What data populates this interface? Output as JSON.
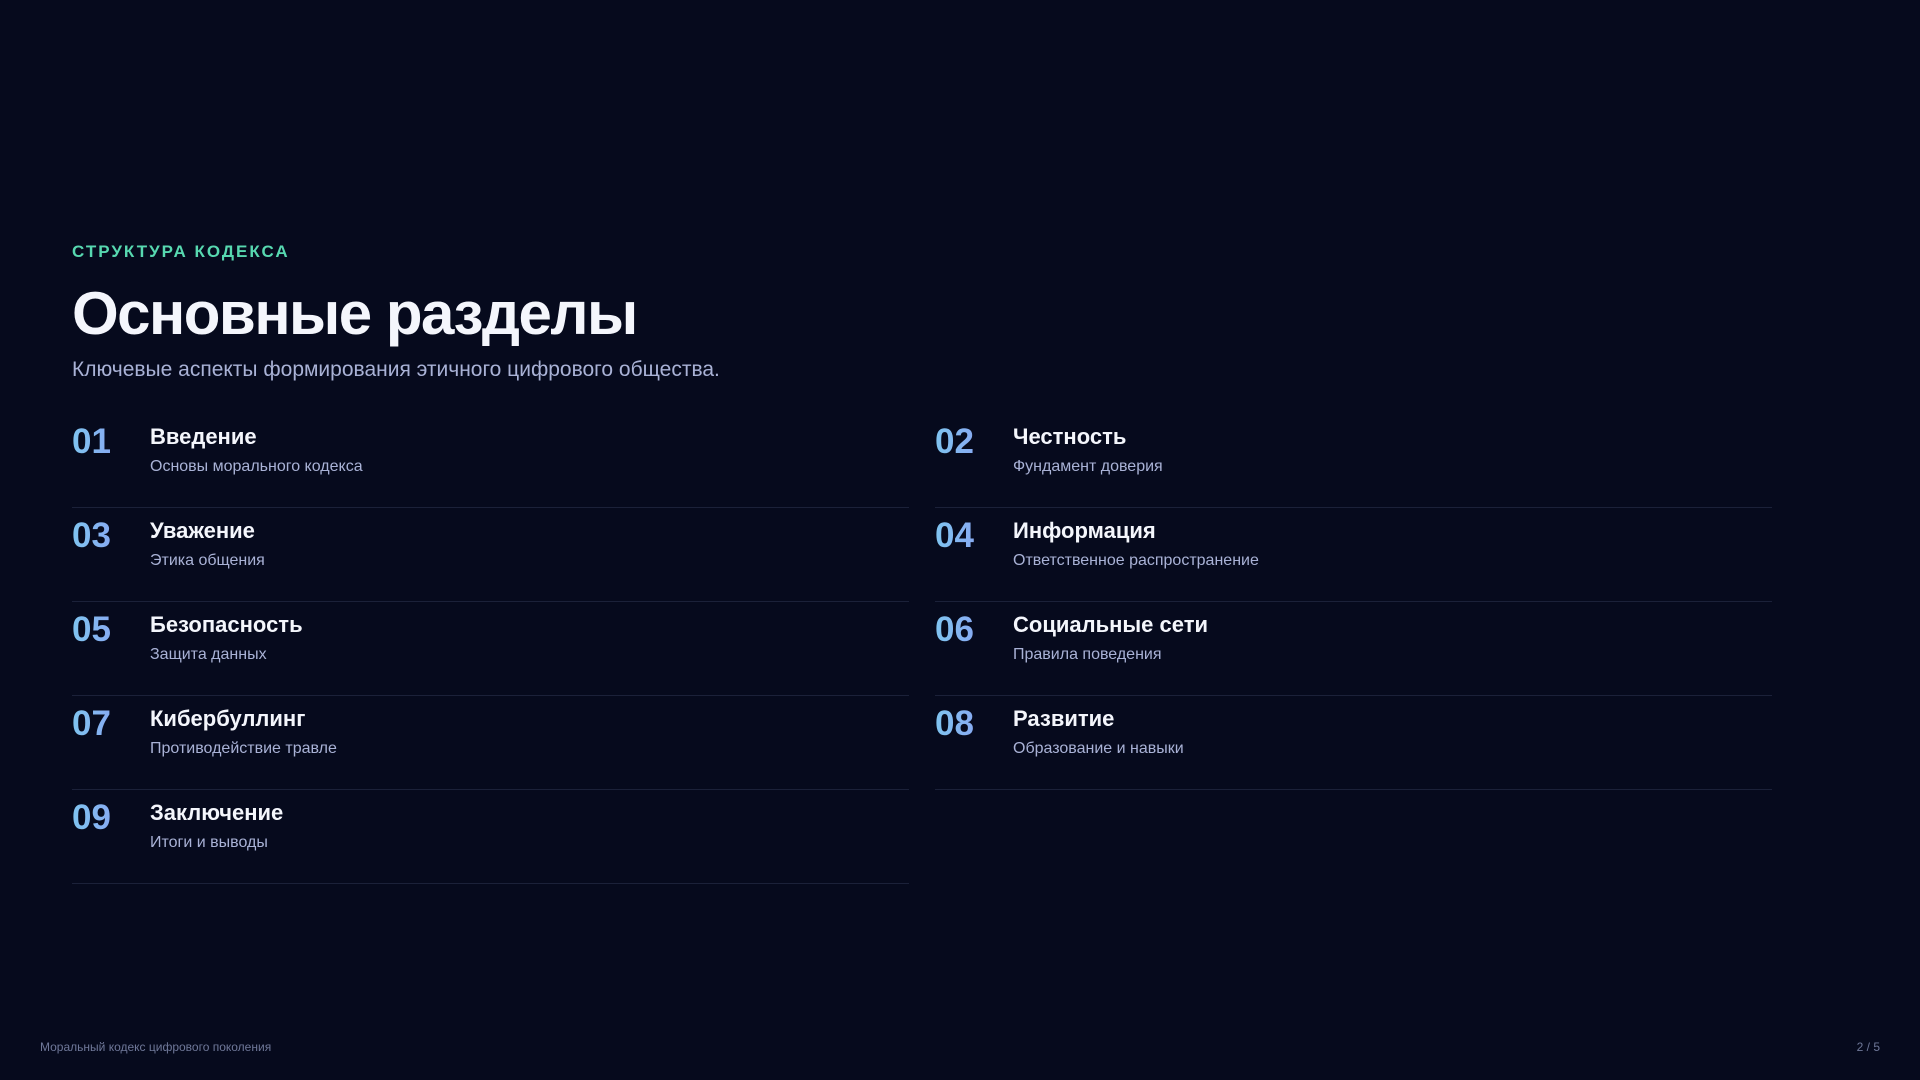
{
  "header": {
    "eyebrow": "СТРУКТУРА КОДЕКСА",
    "title": "Основные разделы",
    "subtitle": "Ключевые аспекты формирования этичного цифрового общества."
  },
  "sections": [
    {
      "num": "01",
      "title": "Введение",
      "desc": "Основы морального кодекса"
    },
    {
      "num": "02",
      "title": "Честность",
      "desc": "Фундамент доверия"
    },
    {
      "num": "03",
      "title": "Уважение",
      "desc": "Этика общения"
    },
    {
      "num": "04",
      "title": "Информация",
      "desc": "Ответственное распространение"
    },
    {
      "num": "05",
      "title": "Безопасность",
      "desc": "Защита данных"
    },
    {
      "num": "06",
      "title": "Социальные сети",
      "desc": "Правила поведения"
    },
    {
      "num": "07",
      "title": "Кибербуллинг",
      "desc": "Противодействие травле"
    },
    {
      "num": "08",
      "title": "Развитие",
      "desc": "Образование и навыки"
    },
    {
      "num": "09",
      "title": "Заключение",
      "desc": "Итоги и выводы"
    }
  ],
  "footer": {
    "left": "Моральный кодекс цифрового поколения",
    "right": "2 / 5"
  },
  "colors": {
    "background": "#060a1d",
    "accent": "#57d8b0",
    "number_gradient_start": "#7fc4f0",
    "number_gradient_end": "#8f93f4"
  }
}
